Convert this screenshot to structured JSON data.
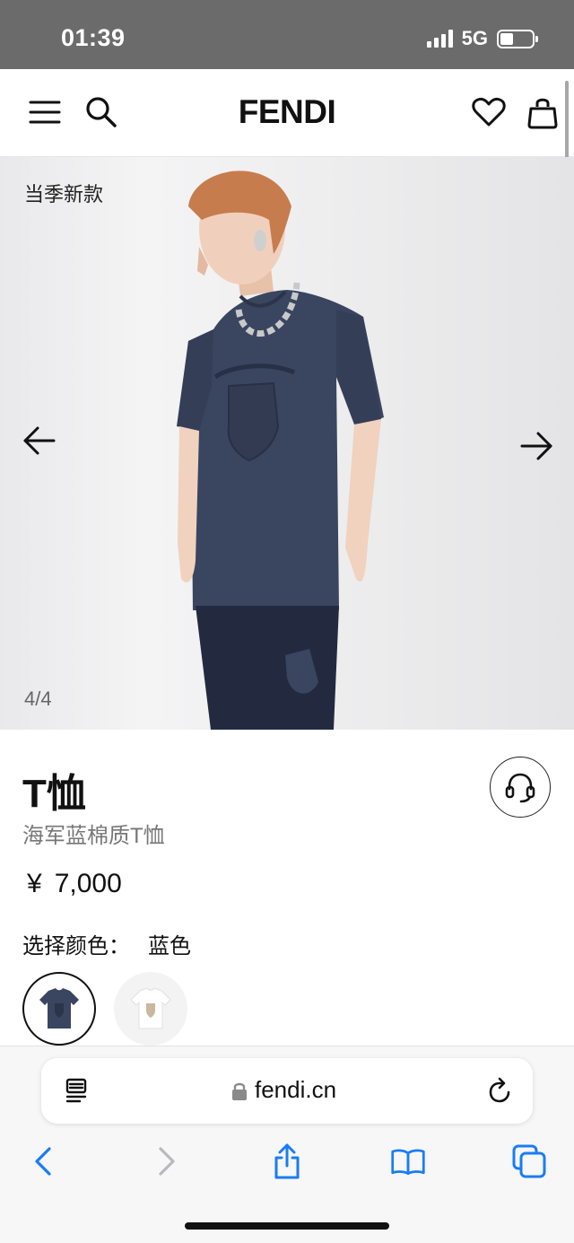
{
  "status_bar": {
    "time": "01:39",
    "network": "5G",
    "battery_level": 0.4
  },
  "header": {
    "brand": "FENDI",
    "icons": [
      "menu-icon",
      "search-icon",
      "heart-icon",
      "bag-icon"
    ]
  },
  "hero": {
    "tag": "当季新款",
    "counter": "4/4"
  },
  "product": {
    "title": "T恤",
    "subtitle": "海军蓝棉质T恤",
    "currency": "¥",
    "price": "7,000",
    "color_label": "选择颜色：",
    "color_value": "蓝色",
    "swatches": [
      "navy",
      "white"
    ]
  },
  "browser": {
    "url": "fendi.cn"
  },
  "colors": {
    "status_bar_bg": "#6b6b6b",
    "ios_blue": "#1a7cf5",
    "shirt_navy": "#3a4560"
  }
}
